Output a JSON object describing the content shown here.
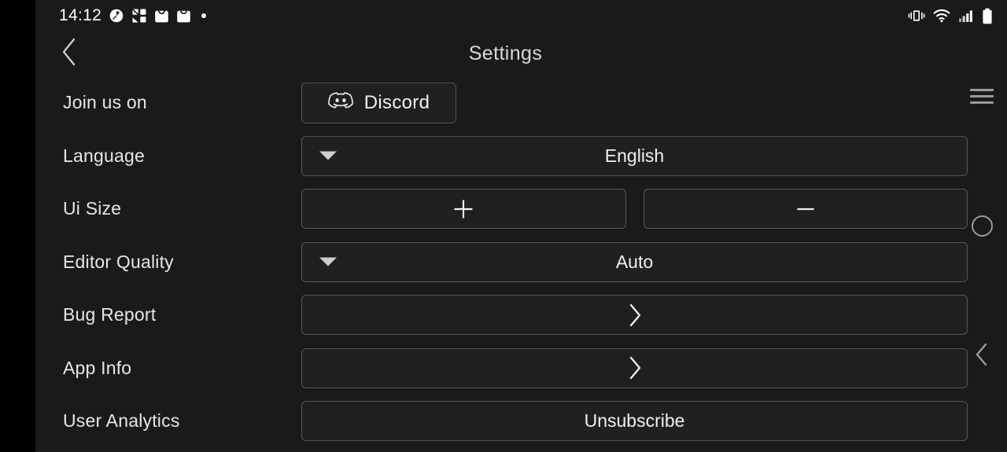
{
  "statusbar": {
    "time": "14:12",
    "left_icons": [
      "clock-icon",
      "app-puzzle-icon",
      "shopping-bag-icon",
      "shopping-bag-icon",
      "dot-indicator-icon"
    ],
    "right_icons": [
      "vibrate-icon",
      "wifi-icon",
      "cellular-signal-icon",
      "battery-icon"
    ]
  },
  "header": {
    "back_icon": "chevron-left-icon",
    "title": "Settings"
  },
  "settings": {
    "rows": [
      {
        "label": "Join us on",
        "type": "discord",
        "button_label": "Discord",
        "icon": "discord-logo-icon"
      },
      {
        "label": "Language",
        "type": "dropdown",
        "value": "English",
        "icon": "caret-down-icon"
      },
      {
        "label": "Ui Size",
        "type": "stepper",
        "increase_label": "+",
        "decrease_label": "—",
        "increase_icon": "plus-icon",
        "decrease_icon": "minus-icon"
      },
      {
        "label": "Editor Quality",
        "type": "dropdown",
        "value": "Auto",
        "icon": "caret-down-icon"
      },
      {
        "label": "Bug Report",
        "type": "navigate",
        "icon": "chevron-right-icon"
      },
      {
        "label": "App Info",
        "type": "navigate",
        "icon": "chevron-right-icon"
      },
      {
        "label": "User Analytics",
        "type": "action",
        "button_label": "Unsubscribe"
      }
    ]
  },
  "navbar": {
    "recents_icon": "hamburger-recents-icon",
    "home_icon": "home-circle-icon",
    "back_icon": "chevron-left-icon"
  },
  "colors": {
    "background": "#1a1a1a",
    "bezel": "#000000",
    "control_fill": "#202020",
    "control_border": "#565656",
    "text_primary": "#e6e6e6",
    "text_title": "#d9d9d9",
    "nav_icon": "#9a9a9a"
  }
}
